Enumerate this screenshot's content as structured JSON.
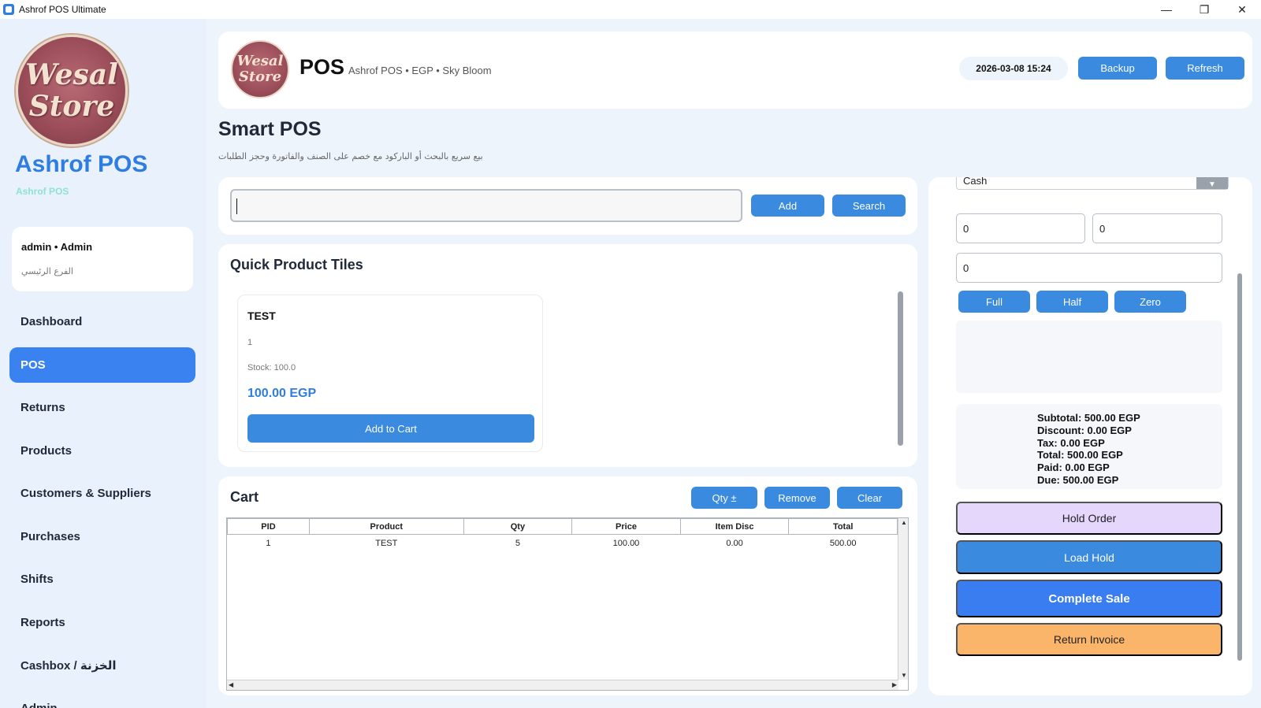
{
  "window": {
    "title": "Ashrof POS Ultimate",
    "controls": [
      "—",
      "❐",
      "✕"
    ]
  },
  "sidebar": {
    "logo_line1": "Wesal",
    "logo_line2": "Store",
    "brand": "Ashrof POS",
    "brand_sub": "Ashrof POS",
    "user_name": "admin • Admin",
    "user_branch": "الفرع الرئيسي",
    "items": [
      {
        "label": "Dashboard"
      },
      {
        "label": "POS"
      },
      {
        "label": "Returns"
      },
      {
        "label": "Products"
      },
      {
        "label": "Customers & Suppliers"
      },
      {
        "label": "Purchases"
      },
      {
        "label": "Shifts"
      },
      {
        "label": "Reports"
      },
      {
        "label": "Cashbox / الخزنة"
      },
      {
        "label": "Admin"
      }
    ]
  },
  "header": {
    "title": "POS",
    "subtitle": "Ashrof POS • EGP • Sky Bloom",
    "datetime": "2026-03-08 15:24",
    "backup_label": "Backup",
    "refresh_label": "Refresh"
  },
  "page": {
    "title": "Smart POS",
    "subtitle": "بيع سريع بالبحث أو الباركود مع خصم على الصنف والفاتورة وحجز الطلبات"
  },
  "search": {
    "value": "",
    "add_label": "Add",
    "search_label": "Search"
  },
  "tiles": {
    "title": "Quick Product Tiles",
    "items": [
      {
        "name": "TEST",
        "code": "1",
        "stock": "Stock: 100.0",
        "price": "100.00 EGP",
        "button": "Add to Cart"
      }
    ]
  },
  "cart": {
    "title": "Cart",
    "qty_label": "Qty ±",
    "remove_label": "Remove",
    "clear_label": "Clear",
    "columns": [
      "PID",
      "Product",
      "Qty",
      "Price",
      "Item Disc",
      "Total"
    ],
    "rows": [
      [
        "1",
        "TEST",
        "5",
        "100.00",
        "0.00",
        "500.00"
      ]
    ]
  },
  "payment": {
    "method": "Cash",
    "input1": "0",
    "input2": "0",
    "input3": "0",
    "full_label": "Full",
    "half_label": "Half",
    "zero_label": "Zero",
    "totals": {
      "subtotal": "Subtotal: 500.00 EGP",
      "discount": "Discount: 0.00 EGP",
      "tax": "Tax: 0.00 EGP",
      "total": "Total: 500.00 EGP",
      "paid": "Paid: 0.00 EGP",
      "due": "Due: 500.00 EGP"
    },
    "hold_label": "Hold Order",
    "load_label": "Load Hold",
    "complete_label": "Complete Sale",
    "return_label": "Return Invoice"
  },
  "colors": {
    "accent": "#3a82f0",
    "button": "#3a8ae0",
    "hold": "#e5d6fb",
    "return": "#fbb56b"
  }
}
